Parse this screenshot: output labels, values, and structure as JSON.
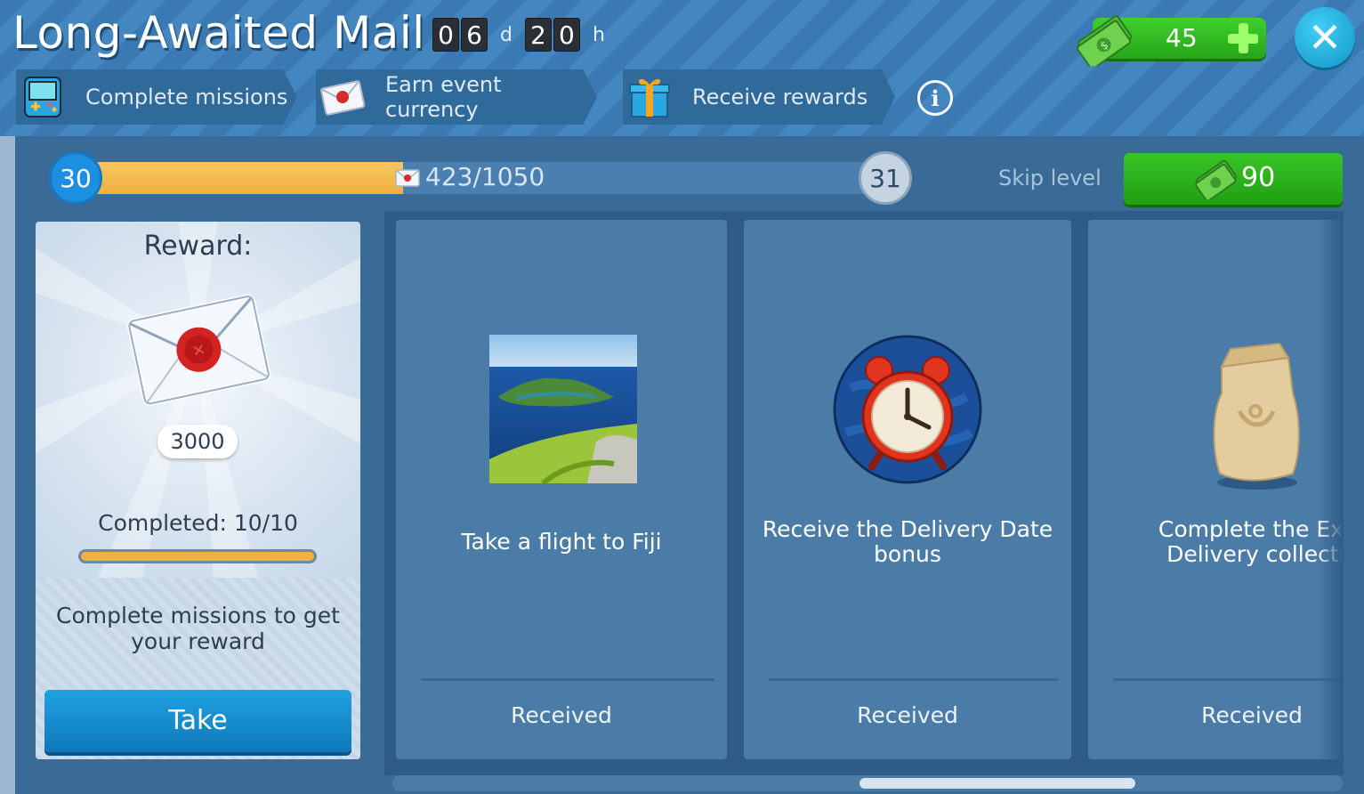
{
  "header": {
    "title": "Long-Awaited Mail",
    "timer": {
      "days_digits": [
        "0",
        "6"
      ],
      "days_unit": "d",
      "hours_digits": [
        "2",
        "0"
      ],
      "hours_unit": "h"
    },
    "currency": {
      "value": "45",
      "icon": "cash-icon",
      "add_icon": "plus-icon"
    },
    "close_icon": "close-icon",
    "steps": [
      {
        "label": "Complete missions",
        "icon": "handheld-console-icon"
      },
      {
        "label": "Earn event currency",
        "icon": "envelope-icon"
      },
      {
        "label": "Receive rewards",
        "icon": "gift-icon"
      }
    ],
    "info_icon": "info-icon"
  },
  "progress": {
    "current_level": "30",
    "next_level": "31",
    "current": 423,
    "total": 1050,
    "text": "423/1050",
    "skip_label": "Skip level",
    "skip_cost": "90"
  },
  "reward": {
    "title": "Reward:",
    "item_icon": "envelope-icon",
    "count": "3000",
    "completed_text": "Completed: 10/10",
    "completed_fraction": 1.0,
    "hint": "Complete missions to get your reward",
    "take_label": "Take"
  },
  "missions": [
    {
      "title": "Take a flight to Fiji",
      "image": "island-photo",
      "status": "Received"
    },
    {
      "title": "Receive the Delivery Date bonus",
      "image": "alarm-clock-icon",
      "status": "Received"
    },
    {
      "title": "Complete the Expr Delivery collectio",
      "image": "mail-sack-icon",
      "status": "Received"
    }
  ],
  "colors": {
    "accent_green": "#26a518",
    "progress_orange": "#f0b13f",
    "button_blue": "#1077b9",
    "header_blue": "#3a79b2"
  }
}
